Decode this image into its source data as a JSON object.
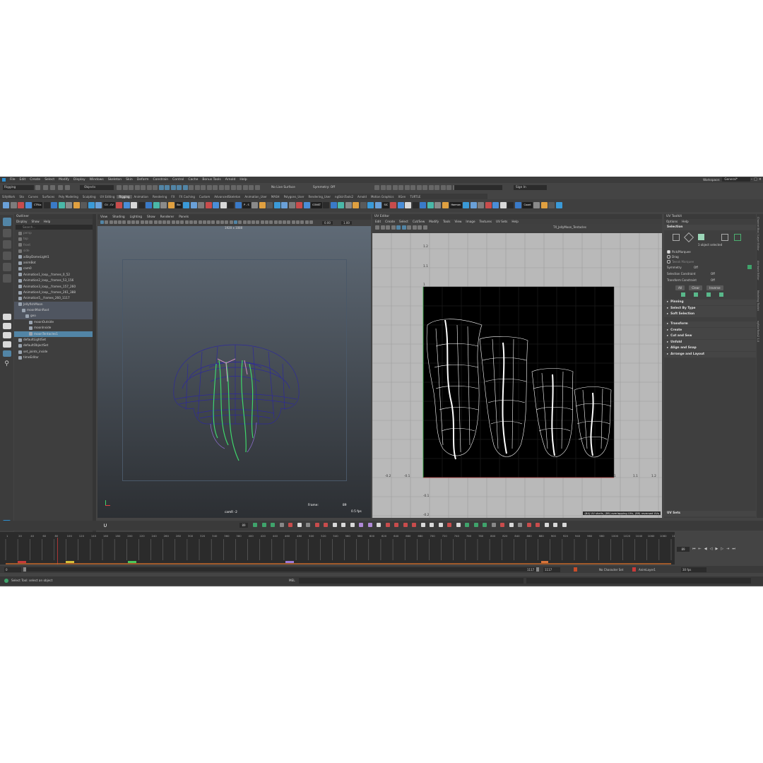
{
  "menubar": {
    "items": [
      "File",
      "Edit",
      "Create",
      "Select",
      "Modify",
      "Display",
      "Windows",
      "Skeleton",
      "Skin",
      "Deform",
      "Constrain",
      "Control",
      "Cache",
      "Bonus Tools",
      "Arnold",
      "Help"
    ],
    "workspace_label": "Workspace:",
    "workspace_value": "General*"
  },
  "statusline": {
    "mode": "Rigging",
    "objects_label": "Objects",
    "surface_label": "No Live Surface",
    "symmetry_label": "Symmetry: Off",
    "signin_label": "Sign In"
  },
  "shelf_tabs": [
    "SillyWork",
    "Sto",
    "Curves",
    "Surfaces",
    "Poly Modeling",
    "Sculpting",
    "UV Editing",
    "Rigging",
    "Animation",
    "Rendering",
    "FX",
    "FX Caching",
    "Custom",
    "AdvancedSkeleton",
    "Animation_User",
    "MASH",
    "Polygons_User",
    "Rendering_User",
    "ngSkinTools2",
    "Arnold",
    "Motion Graphics",
    "XGen",
    "TURTLE"
  ],
  "shelf_active": "Rigging",
  "shelf_button_labels": [
    "CTRLs",
    "CV - CV",
    "Bio",
    "P - S",
    "CONST",
    "SIC",
    "Harmon",
    "Count",
    "Skn",
    "Cone",
    "OB/Seg",
    "Ribbon re - dup",
    "export",
    "O.Obj",
    "Dy.Chain",
    "Cone",
    "IB"
  ],
  "outliner": {
    "title": "Outliner",
    "menus": [
      "Display",
      "Show",
      "Help"
    ],
    "search_placeholder": "Search...",
    "items": [
      {
        "label": "persp",
        "indent": 0,
        "dim": true
      },
      {
        "label": "top",
        "indent": 0,
        "dim": true
      },
      {
        "label": "front",
        "indent": 0,
        "dim": true
      },
      {
        "label": "side",
        "indent": 0,
        "dim": true
      },
      {
        "label": "aiSkyDomeLight1",
        "indent": 0
      },
      {
        "label": "animBot",
        "indent": 0
      },
      {
        "label": "cam0",
        "indent": 0
      },
      {
        "label": "Animation1_loop__frames_0_52",
        "indent": 0
      },
      {
        "label": "Animation2_loop__frames_53_156",
        "indent": 0
      },
      {
        "label": "Animation3_loop__frames_157_260",
        "indent": 0
      },
      {
        "label": "Animation4_loop__frames_261_388",
        "indent": 0
      },
      {
        "label": "Animation5__frames_260_1117",
        "indent": 0
      },
      {
        "label": "JellyfishMoon",
        "indent": 0,
        "sel": "dark"
      },
      {
        "label": "moonMainRoot",
        "indent": 1,
        "sel": "dark"
      },
      {
        "label": "geo",
        "indent": 2,
        "sel": "dark"
      },
      {
        "label": "moonOutside",
        "indent": 3
      },
      {
        "label": "moonInside",
        "indent": 3
      },
      {
        "label": "moonTentacles1",
        "indent": 3,
        "sel": "blue"
      },
      {
        "label": "defaultLightSet",
        "indent": 0
      },
      {
        "label": "defaultObjectSet",
        "indent": 0
      },
      {
        "label": "set_joints_inside",
        "indent": 0
      },
      {
        "label": "timeEditor",
        "indent": 0
      }
    ]
  },
  "viewport": {
    "menus": [
      "View",
      "Shading",
      "Lighting",
      "Show",
      "Renderer",
      "Panels"
    ],
    "resolution": "1920 x 1080",
    "exposure": "0.00",
    "gamma": "1.00",
    "camera_label": "camR -2",
    "frame_label": "Frame:",
    "frame_value": "89",
    "fps": "0.5 fps"
  },
  "uv_editor": {
    "title": "UV Editor",
    "menus": [
      "Edit",
      "Create",
      "Select",
      "Cut/Sew",
      "Modify",
      "Tools",
      "View",
      "Image",
      "Textures",
      "UV Sets",
      "Help"
    ],
    "texture_name": "TX_JellyMoon_Tentacles",
    "v_ticks": [
      "1.2",
      "1.1",
      "1",
      "0.1",
      "-0.1",
      "-0.2"
    ],
    "u_ticks": [
      "-0.2",
      "-0.1",
      "0",
      "1",
      "1.1",
      "1.2"
    ],
    "status": "(84) UV shells, (89) overlapping UVs, (89) reversed UVs"
  },
  "uv_toolkit": {
    "title": "UV Toolkit",
    "menus": [
      "Options",
      "Help"
    ],
    "selection_header": "Selection",
    "selected_info": "1 object selected",
    "radio_options": [
      "Pick/Marquee",
      "Drag",
      "Tweak Marquee"
    ],
    "symmetry_label": "Symmetry",
    "symmetry_value": "Off",
    "selection_constraint_label": "Selection Constraint",
    "selection_constraint_value": "Off",
    "transform_constraint_label": "Transform Constraint",
    "transform_constraint_value": "Off",
    "buttons": [
      "All",
      "Clear",
      "Inverse"
    ],
    "sections": [
      "Pinning",
      "Select By Type",
      "Soft Selection",
      "Transform",
      "Create",
      "Cut and Sew",
      "Unfold",
      "Align and Snap",
      "Arrange and Layout"
    ],
    "uv_sets": "UV Sets",
    "side_tabs": [
      "Channel Box / Layer Editor",
      "Attribute Editor",
      "Modeling Toolkit",
      "ngSkinTools2 1.0"
    ]
  },
  "timeslider": {
    "ticks": [
      "1",
      "20",
      "40",
      "60",
      "80",
      "100",
      "120",
      "140",
      "160",
      "180",
      "200",
      "220",
      "240",
      "260",
      "280",
      "300",
      "320",
      "340",
      "360",
      "380",
      "400",
      "420",
      "440",
      "460",
      "480",
      "500",
      "520",
      "540",
      "560",
      "580",
      "600",
      "620",
      "640",
      "660",
      "680",
      "700",
      "720",
      "740",
      "760",
      "780",
      "800",
      "820",
      "840",
      "860",
      "880",
      "900",
      "920",
      "940",
      "960",
      "980",
      "1000",
      "1020",
      "1040",
      "1060",
      "1080",
      "1100"
    ],
    "current_frame": "89",
    "key_fraction": 0.078
  },
  "range": {
    "start": "0",
    "end_a": "1117",
    "end_b": "1117",
    "character_set": "No Character Set",
    "anim_layer": "AnimLayer1",
    "fps": "30 fps"
  },
  "cmdline": {
    "help_text": "Select Tool: select an object",
    "lang": "MEL"
  },
  "colors": {
    "app_bg": "#444444",
    "selection_blue": "#5285a6",
    "uv_lines": "#ffffff",
    "uv_tile": "#000000",
    "mesh_wire": "#2e2a9a",
    "mesh_green": "#3fd66b"
  }
}
